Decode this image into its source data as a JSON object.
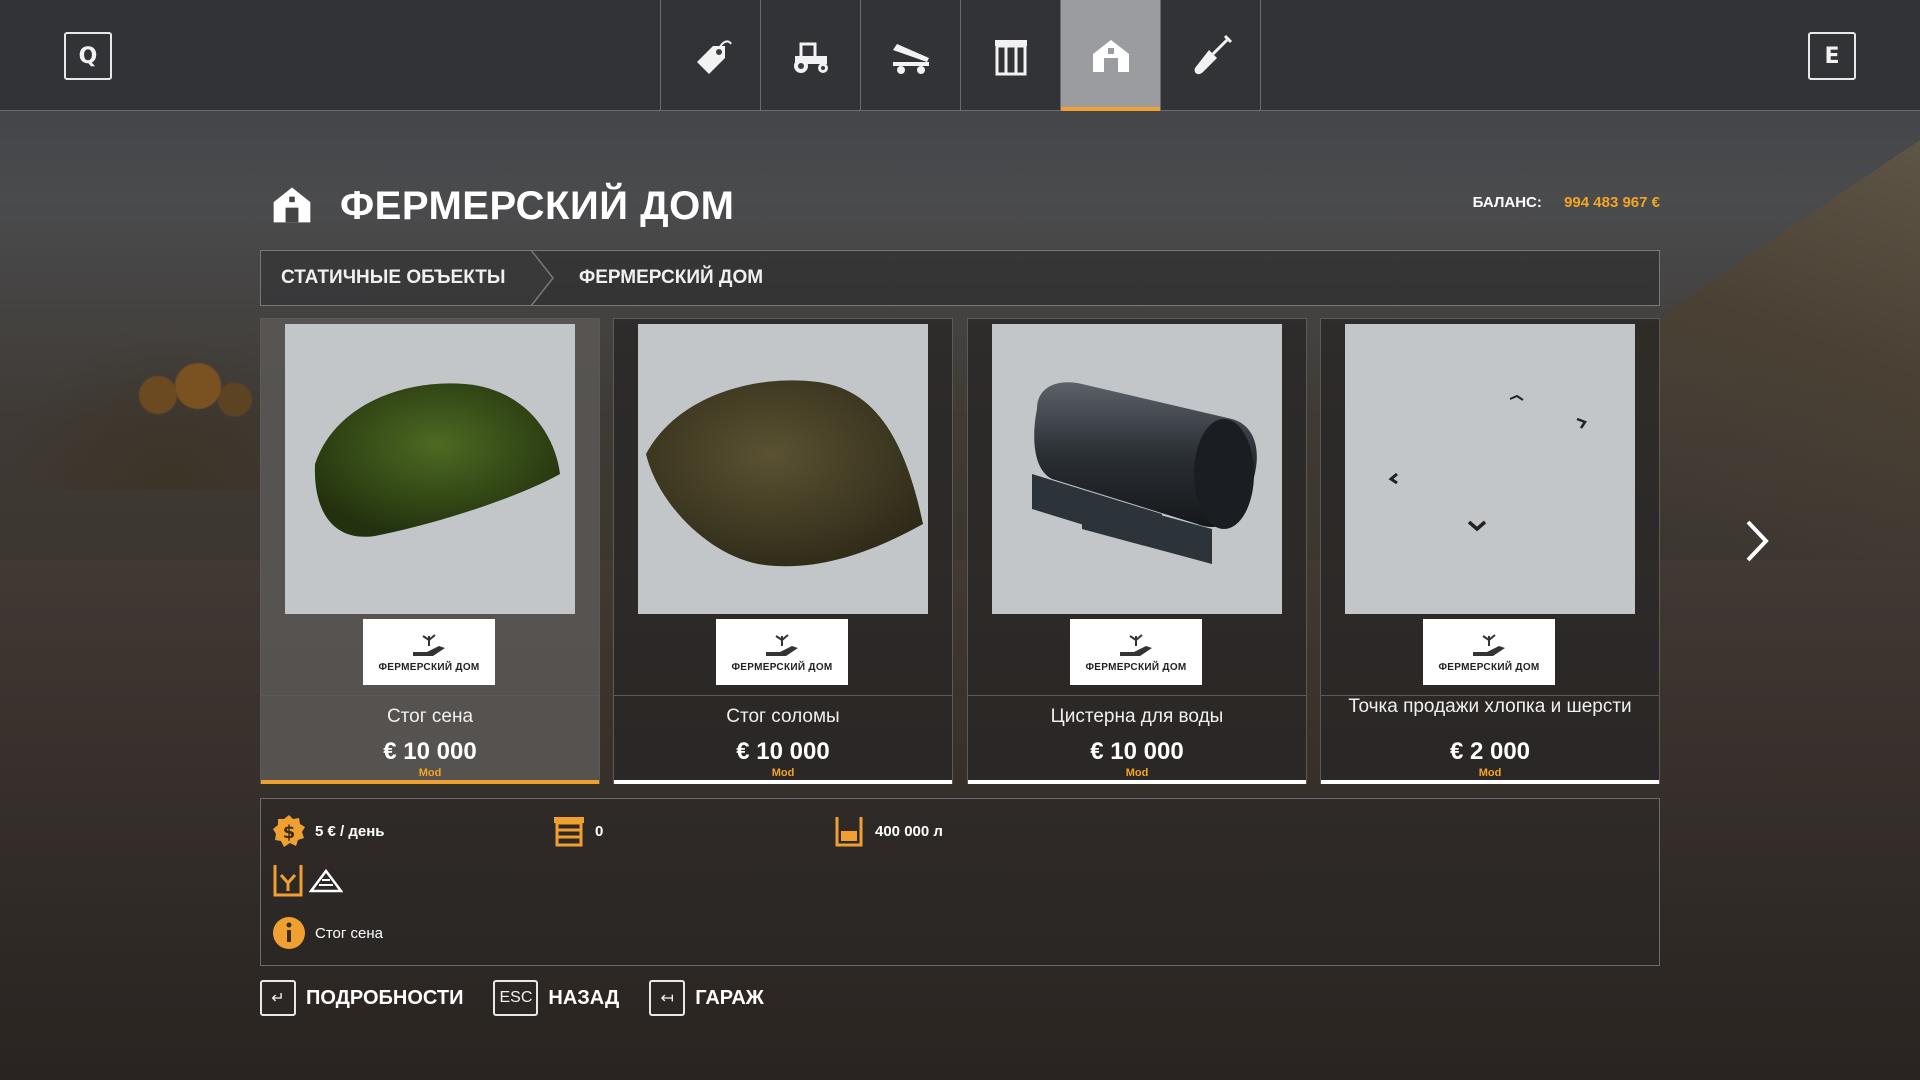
{
  "topbar": {
    "left_key": "Q",
    "right_key": "E",
    "tabs": [
      {
        "icon": "price-tag-icon",
        "active": false
      },
      {
        "icon": "tractor-icon",
        "active": false
      },
      {
        "icon": "tipper-trailer-icon",
        "active": false
      },
      {
        "icon": "silo-icon",
        "active": false
      },
      {
        "icon": "farmhouse-icon",
        "active": true
      },
      {
        "icon": "shovel-icon",
        "active": false
      }
    ]
  },
  "header": {
    "title": "ФЕРМЕРСКИЙ ДОМ",
    "balance_label": "БАЛАНС:",
    "balance_value": "994 483 967 €"
  },
  "breadcrumb": {
    "items": [
      "СТАТИЧНЫЕ ОБЪЕКТЫ",
      "ФЕРМЕРСКИЙ ДОМ"
    ]
  },
  "cards": [
    {
      "name": "Стог сена",
      "price": "€ 10 000",
      "tag": "Mod",
      "logo_text": "ФЕРМЕРСКИЙ ДОМ",
      "selected": true,
      "thumb": "hay-stack"
    },
    {
      "name": "Стог соломы",
      "price": "€ 10 000",
      "tag": "Mod",
      "logo_text": "ФЕРМЕРСКИЙ ДОМ",
      "selected": false,
      "thumb": "straw-stack"
    },
    {
      "name": "Цистерна для воды",
      "price": "€ 10 000",
      "tag": "Mod",
      "logo_text": "ФЕРМЕРСКИЙ ДОМ",
      "selected": false,
      "thumb": "water-tank"
    },
    {
      "name": "Точка продажи хлопка и шерсти",
      "price": "€ 2 000",
      "tag": "Mod",
      "logo_text": "ФЕРМЕРСКИЙ ДОМ",
      "selected": false,
      "thumb": "selling-point"
    }
  ],
  "details": {
    "upkeep": "5 € / день",
    "slots": "0",
    "capacity": "400 000 л",
    "description": "Стог сена"
  },
  "actions": [
    {
      "key": "↵",
      "label": "ПОДРОБНОСТИ"
    },
    {
      "key": "ESC",
      "label": "НАЗАД"
    },
    {
      "key": "↤",
      "label": "ГАРАЖ"
    }
  ],
  "colors": {
    "accent": "#f0a030",
    "balance": "#f3a623",
    "active_tab": "#9a9ca0"
  }
}
